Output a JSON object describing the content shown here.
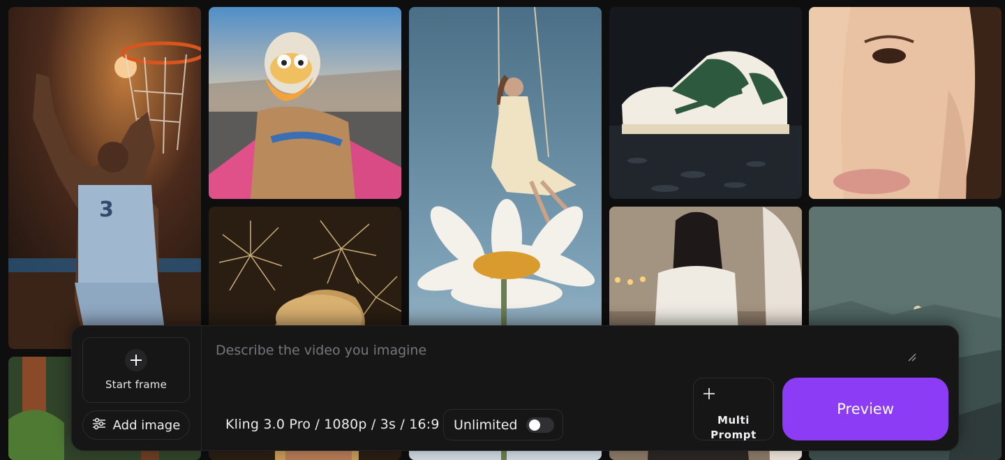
{
  "gallery": {
    "tiles": [
      {
        "name": "tile-basketball",
        "subject": "basketball player dunking"
      },
      {
        "name": "tile-duck-racer",
        "subject": "duck in racing kart"
      },
      {
        "name": "tile-swing-daisy",
        "subject": "woman on swing above daisy"
      },
      {
        "name": "tile-sneaker",
        "subject": "green sneaker on water"
      },
      {
        "name": "tile-face",
        "subject": "close-up face"
      },
      {
        "name": "tile-fireworks",
        "subject": "man with fireworks"
      },
      {
        "name": "tile-woman-room",
        "subject": "woman in white top"
      },
      {
        "name": "tile-landscape",
        "subject": "misty mountains and moon"
      },
      {
        "name": "tile-forest",
        "subject": "forest"
      }
    ]
  },
  "composer": {
    "start_frame_label": "Start frame",
    "add_image_label": "Add image",
    "prompt_placeholder": "Describe the video you imagine",
    "prompt_value": "",
    "model_settings": "Kling 3.0 Pro / 1080p / 3s / 16:9",
    "unlimited_label": "Unlimited",
    "unlimited_enabled": false,
    "multi_prompt_line1": "Multi",
    "multi_prompt_line2": "Prompt",
    "preview_label": "Preview",
    "accent_color": "#8c3cf5"
  },
  "icons": {
    "start_frame": "plus-icon",
    "add_image": "sliders-icon",
    "resize": "resize-handle-icon",
    "multi_prompt": "plus-icon",
    "toggle": "toggle-switch"
  }
}
